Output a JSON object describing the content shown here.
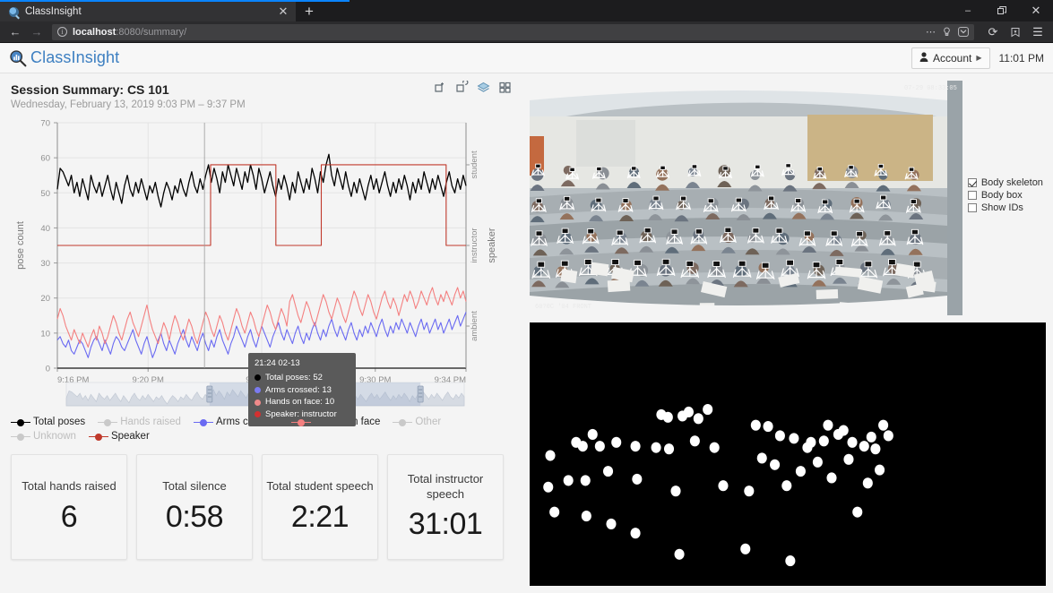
{
  "browser": {
    "tab_title": "ClassInsight",
    "favicon_name": "classinsight-favicon",
    "new_tab_label": "+",
    "close_tab_label": "✕",
    "window_minimize": "–",
    "window_restore": "❐",
    "window_close": "✕",
    "back_label": "←",
    "forward_label": "→",
    "reload_label": "⟳",
    "info_label": "i",
    "url_host": "localhost",
    "url_path": ":8080/summary/",
    "menu_label": "☰",
    "overflow_label": "⋯",
    "bookmark_label": "☆"
  },
  "app": {
    "brand": "ClassInsight",
    "account_label": "Account",
    "account_caret": "▶",
    "clock": "11:01 PM"
  },
  "session": {
    "title": "Session Summary: CS 101",
    "subtitle": "Wednesday, February 13, 2019 9:03 PM – 9:37 PM"
  },
  "chart_tools": [
    {
      "name": "crop-add-icon"
    },
    {
      "name": "crop-undo-icon"
    },
    {
      "name": "layers-icon",
      "color": "#7fb3d5"
    },
    {
      "name": "grid-icon"
    }
  ],
  "tooltip": {
    "title": "21:24 02-13",
    "rows": [
      {
        "label": "Total poses: 52",
        "color": "#000000"
      },
      {
        "label": "Arms crossed: 13",
        "color": "#7b7bf0"
      },
      {
        "label": "Hands on face: 10",
        "color": "#f08a8a"
      },
      {
        "label": "Speaker: instructor",
        "color": "#d33030"
      }
    ]
  },
  "legend": [
    {
      "label": "Total poses",
      "color": "#000000",
      "active": true
    },
    {
      "label": "Hands raised",
      "color": "#c9c9c9",
      "active": false
    },
    {
      "label": "Arms crossed",
      "color": "#6a6af2",
      "active": true
    },
    {
      "label": "Hands on face",
      "color": "#f48080",
      "active": true
    },
    {
      "label": "Other",
      "color": "#c9c9c9",
      "active": false
    },
    {
      "label": "Unknown",
      "color": "#c9c9c9",
      "active": false
    },
    {
      "label": "Speaker",
      "color": "#c0392b",
      "active": true
    }
  ],
  "cards": [
    {
      "label": "Total hands raised",
      "value": "6"
    },
    {
      "label": "Total silence",
      "value": "0:58"
    },
    {
      "label": "Total student speech",
      "value": "2:21"
    },
    {
      "label": "Total instructor speech",
      "value": "31:01"
    }
  ],
  "video": {
    "timestamp_top_right": "07-29 08:33:05",
    "timestamp_bottom_left": "60?0C '04 FRONT",
    "overlay_name": "skeleton-overlay"
  },
  "view_options": [
    {
      "label": "Body skeleton",
      "checked": true
    },
    {
      "label": "Body box",
      "checked": false
    },
    {
      "label": "Show IDs",
      "checked": false
    }
  ],
  "chart_data": {
    "type": "line",
    "title": "",
    "xlabel": "",
    "ylabel": "pose count",
    "ylim": [
      0,
      70
    ],
    "yticks": [
      0,
      10,
      20,
      30,
      40,
      50,
      60,
      70
    ],
    "xticks": [
      "9:16 PM",
      "9:20 PM",
      "9:25 PM",
      "9:30 PM",
      "9:34 PM"
    ],
    "xtick_positions": [
      0,
      0.222,
      0.5,
      0.778,
      1.0
    ],
    "grid": true,
    "legend_position": "bottom",
    "right_axis": {
      "label": "speaker",
      "categories": [
        "student",
        "instructor",
        "ambient"
      ],
      "category_values": [
        58,
        35,
        12
      ]
    },
    "brush": {
      "selection_start": 0.36,
      "selection_end": 0.89
    },
    "series": [
      {
        "name": "Total poses",
        "color": "#000000",
        "values": [
          51,
          57,
          56,
          54,
          52,
          55,
          50,
          53,
          49,
          54,
          51,
          48,
          55,
          52,
          50,
          53,
          49,
          52,
          55,
          51,
          48,
          53,
          50,
          47,
          52,
          55,
          51,
          49,
          53,
          50,
          54,
          51,
          48,
          52,
          50,
          53,
          49,
          46,
          50,
          53,
          51,
          48,
          52,
          50,
          54,
          51,
          49,
          53,
          56,
          52,
          50,
          54,
          51,
          55,
          58,
          53,
          57,
          54,
          50,
          56,
          53,
          58,
          55,
          52,
          57,
          54,
          51,
          56,
          53,
          58,
          55,
          51,
          57,
          54,
          50,
          53,
          56,
          52,
          49,
          54,
          51,
          55,
          52,
          48,
          53,
          50,
          56,
          53,
          50,
          54,
          51,
          57,
          54,
          50,
          56,
          53,
          58,
          61,
          55,
          52,
          57,
          54,
          51,
          56,
          52,
          49,
          53,
          50,
          54,
          51,
          48,
          52,
          55,
          51,
          54,
          50,
          53,
          56,
          52,
          49,
          53,
          50,
          54,
          51,
          55,
          52,
          48,
          53,
          50,
          54,
          51,
          56,
          53,
          50,
          54,
          51,
          55,
          52,
          49,
          53,
          56,
          52,
          50,
          54,
          51,
          55,
          52
        ]
      },
      {
        "name": "Arms crossed",
        "color": "#6a6af2",
        "values": [
          8,
          9,
          7,
          6,
          8,
          5,
          4,
          6,
          8,
          7,
          5,
          3,
          6,
          8,
          9,
          7,
          5,
          8,
          6,
          4,
          7,
          9,
          8,
          6,
          5,
          7,
          9,
          11,
          8,
          6,
          4,
          7,
          9,
          6,
          3,
          5,
          8,
          10,
          7,
          5,
          8,
          6,
          4,
          7,
          9,
          11,
          8,
          6,
          9,
          7,
          5,
          8,
          10,
          7,
          5,
          8,
          6,
          9,
          11,
          8,
          6,
          4,
          7,
          9,
          12,
          10,
          8,
          6,
          9,
          11,
          8,
          6,
          9,
          12,
          10,
          8,
          6,
          9,
          11,
          13,
          10,
          8,
          11,
          9,
          7,
          10,
          12,
          9,
          7,
          10,
          8,
          11,
          13,
          10,
          8,
          11,
          9,
          12,
          14,
          11,
          9,
          12,
          10,
          8,
          11,
          13,
          10,
          8,
          11,
          9,
          12,
          10,
          13,
          11,
          9,
          12,
          14,
          11,
          9,
          12,
          10,
          13,
          11,
          14,
          12,
          10,
          13,
          11,
          9,
          12,
          14,
          11,
          13,
          10,
          12,
          14,
          11,
          13,
          10,
          12,
          14,
          11,
          13,
          15,
          12,
          14,
          16
        ]
      },
      {
        "name": "Hands on face",
        "color": "#f48080",
        "values": [
          14,
          17,
          15,
          12,
          10,
          8,
          11,
          9,
          7,
          10,
          8,
          6,
          9,
          11,
          8,
          12,
          10,
          7,
          9,
          12,
          15,
          13,
          10,
          8,
          11,
          14,
          16,
          13,
          11,
          9,
          12,
          15,
          18,
          14,
          11,
          9,
          7,
          10,
          13,
          11,
          8,
          12,
          15,
          13,
          10,
          8,
          11,
          14,
          12,
          9,
          7,
          10,
          13,
          16,
          14,
          11,
          9,
          12,
          15,
          13,
          10,
          8,
          11,
          14,
          17,
          15,
          12,
          10,
          13,
          16,
          14,
          11,
          9,
          12,
          15,
          18,
          16,
          13,
          11,
          14,
          17,
          15,
          12,
          19,
          21,
          18,
          15,
          13,
          16,
          19,
          17,
          14,
          12,
          15,
          18,
          21,
          19,
          16,
          14,
          17,
          20,
          18,
          15,
          13,
          16,
          19,
          22,
          20,
          17,
          15,
          18,
          21,
          19,
          16,
          14,
          17,
          20,
          22,
          19,
          17,
          20,
          18,
          15,
          18,
          21,
          19,
          22,
          20,
          17,
          19,
          22,
          20,
          18,
          21,
          23,
          20,
          18,
          21,
          19,
          22,
          20,
          18,
          21,
          23,
          20,
          22,
          19
        ]
      },
      {
        "name": "Speaker",
        "color": "#c0392b",
        "step": true,
        "values": [
          35,
          35,
          35,
          35,
          35,
          35,
          35,
          35,
          35,
          35,
          35,
          35,
          35,
          35,
          35,
          35,
          35,
          35,
          35,
          35,
          35,
          35,
          35,
          35,
          35,
          35,
          35,
          35,
          35,
          35,
          35,
          35,
          35,
          35,
          35,
          35,
          35,
          35,
          35,
          35,
          35,
          35,
          35,
          35,
          35,
          35,
          35,
          35,
          35,
          35,
          35,
          35,
          35,
          35,
          58,
          58,
          58,
          58,
          58,
          58,
          58,
          58,
          58,
          58,
          58,
          58,
          58,
          58,
          58,
          58,
          58,
          58,
          58,
          58,
          58,
          58,
          58,
          35,
          35,
          35,
          35,
          35,
          35,
          35,
          35,
          35,
          35,
          35,
          35,
          35,
          35,
          35,
          35,
          58,
          58,
          58,
          58,
          58,
          58,
          58,
          58,
          58,
          58,
          58,
          58,
          58,
          58,
          58,
          58,
          58,
          58,
          58,
          58,
          58,
          58,
          58,
          58,
          58,
          58,
          58,
          58,
          58,
          58,
          58,
          58,
          58,
          58,
          58,
          58,
          58,
          58,
          58,
          58,
          58,
          58,
          58,
          58,
          35,
          35,
          35,
          35,
          35,
          35,
          35,
          35
        ]
      }
    ]
  },
  "seat_map": {
    "name": "seat-position-map",
    "background": "#000000",
    "dot_color": "#ffffff",
    "dots": [
      [
        0.04,
        0.505
      ],
      [
        0.036,
        0.625
      ],
      [
        0.048,
        0.72
      ],
      [
        0.075,
        0.6
      ],
      [
        0.09,
        0.455
      ],
      [
        0.103,
        0.47
      ],
      [
        0.108,
        0.6
      ],
      [
        0.11,
        0.735
      ],
      [
        0.122,
        0.425
      ],
      [
        0.136,
        0.47
      ],
      [
        0.152,
        0.565
      ],
      [
        0.158,
        0.765
      ],
      [
        0.168,
        0.455
      ],
      [
        0.205,
        0.8
      ],
      [
        0.205,
        0.47
      ],
      [
        0.208,
        0.595
      ],
      [
        0.245,
        0.475
      ],
      [
        0.255,
        0.35
      ],
      [
        0.268,
        0.36
      ],
      [
        0.27,
        0.48
      ],
      [
        0.283,
        0.64
      ],
      [
        0.29,
        0.88
      ],
      [
        0.296,
        0.355
      ],
      [
        0.308,
        0.34
      ],
      [
        0.32,
        0.45
      ],
      [
        0.327,
        0.365
      ],
      [
        0.345,
        0.33
      ],
      [
        0.358,
        0.475
      ],
      [
        0.375,
        0.62
      ],
      [
        0.418,
        0.86
      ],
      [
        0.425,
        0.64
      ],
      [
        0.438,
        0.39
      ],
      [
        0.45,
        0.515
      ],
      [
        0.462,
        0.395
      ],
      [
        0.475,
        0.54
      ],
      [
        0.485,
        0.43
      ],
      [
        0.498,
        0.62
      ],
      [
        0.505,
        0.905
      ],
      [
        0.512,
        0.44
      ],
      [
        0.525,
        0.565
      ],
      [
        0.538,
        0.475
      ],
      [
        0.545,
        0.455
      ],
      [
        0.558,
        0.53
      ],
      [
        0.57,
        0.45
      ],
      [
        0.578,
        0.39
      ],
      [
        0.585,
        0.59
      ],
      [
        0.598,
        0.425
      ],
      [
        0.608,
        0.41
      ],
      [
        0.618,
        0.52
      ],
      [
        0.625,
        0.455
      ],
      [
        0.635,
        0.72
      ],
      [
        0.648,
        0.47
      ],
      [
        0.655,
        0.61
      ],
      [
        0.662,
        0.435
      ],
      [
        0.67,
        0.48
      ],
      [
        0.678,
        0.56
      ],
      [
        0.685,
        0.39
      ],
      [
        0.695,
        0.43
      ]
    ]
  }
}
